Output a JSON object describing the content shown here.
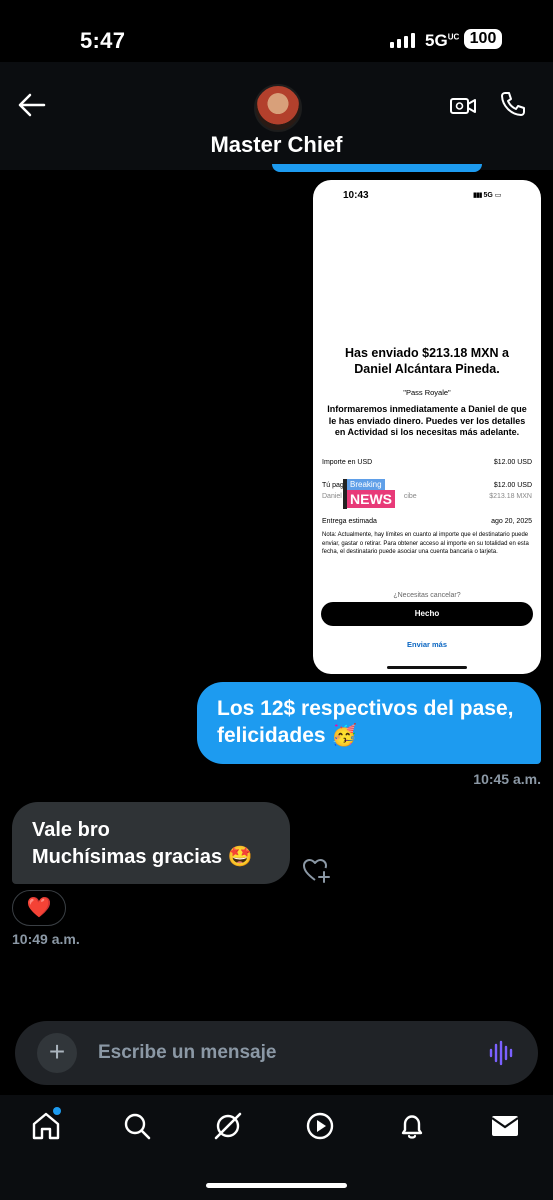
{
  "status_bar": {
    "time": "5:47",
    "network": "5G",
    "network_sup": "UC",
    "battery": "100"
  },
  "header": {
    "contact_name": "Master Chief"
  },
  "attachment": {
    "status_time": "10:43",
    "status_right": "5G",
    "title": "Has enviado $213.18 MXN a Daniel Alcántara Pineda.",
    "quote": "\"Pass Royale\"",
    "info": "Informaremos inmediatamente a Daniel de que le has enviado dinero. Puedes ver los detalles en Actividad si los necesitas más adelante.",
    "rows": [
      {
        "label": "Importe en USD",
        "value": "$12.00 USD"
      },
      {
        "label": "Tú pag",
        "value": "$12.00 USD"
      },
      {
        "label": "Daniel",
        "label_suffix": "cibe",
        "value": "$213.18 MXN"
      },
      {
        "label": "Entrega estimada",
        "value": "ago 20, 2025"
      }
    ],
    "note": "Nota: Actualmente, hay límites en cuanto al importe que el destinatario puede enviar, gastar o retirar. Para obtener acceso al importe en su totalidad en esta fecha, el destinatario puede asociar una cuenta bancaria o tarjeta.",
    "cancel_text": "¿Necesitas cancelar?",
    "done_button": "Hecho",
    "send_more": "Enviar más",
    "badge_small": "Breaking",
    "badge_big": "NEWS"
  },
  "messages": [
    {
      "direction": "out",
      "text": "Los 12$ respectivos del pase, felicidades 🥳",
      "time": "10:45 a.m."
    },
    {
      "direction": "in",
      "text": "Vale bro\nMuchísimas gracias 🤩",
      "time": "10:49 a.m.",
      "reaction": "❤️"
    }
  ],
  "composer": {
    "placeholder": "Escribe un mensaje"
  },
  "nav": {
    "items": [
      "home-icon",
      "search-icon",
      "grok-icon",
      "play-icon",
      "bell-icon",
      "mail-icon"
    ]
  },
  "colors": {
    "accent": "#1d9bf0",
    "bubble_in": "#2f3336",
    "background": "#000000"
  }
}
